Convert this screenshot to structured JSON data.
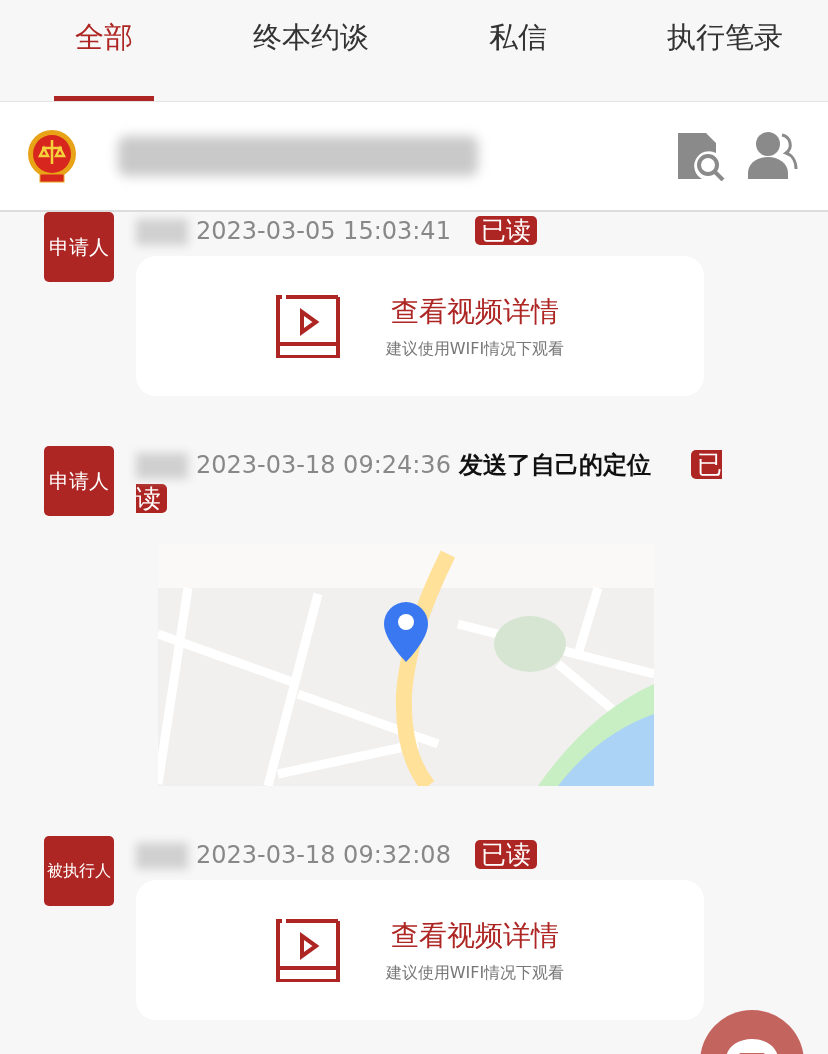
{
  "tabs": [
    {
      "label": "全部",
      "selected": true
    },
    {
      "label": "终本约谈",
      "selected": false
    },
    {
      "label": "私信",
      "selected": false
    },
    {
      "label": "执行笔录",
      "selected": false
    }
  ],
  "messages": [
    {
      "kind": "video",
      "role": "申请人",
      "time": "2023-03-05 15:03:41",
      "badge": "已读",
      "card": {
        "title": "查看视频详情",
        "hint": "建议使用WIFI情况下观看"
      }
    },
    {
      "kind": "location",
      "role": "申请人",
      "time": "2023-03-18 09:24:36",
      "action": "发送了自己的定位",
      "badge": "已读"
    },
    {
      "kind": "video",
      "role": "被执行人",
      "time": "2023-03-18 09:32:08",
      "badge": "已读",
      "card": {
        "title": "查看视频详情",
        "hint": "建议使用WIFI情况下观看"
      }
    }
  ]
}
